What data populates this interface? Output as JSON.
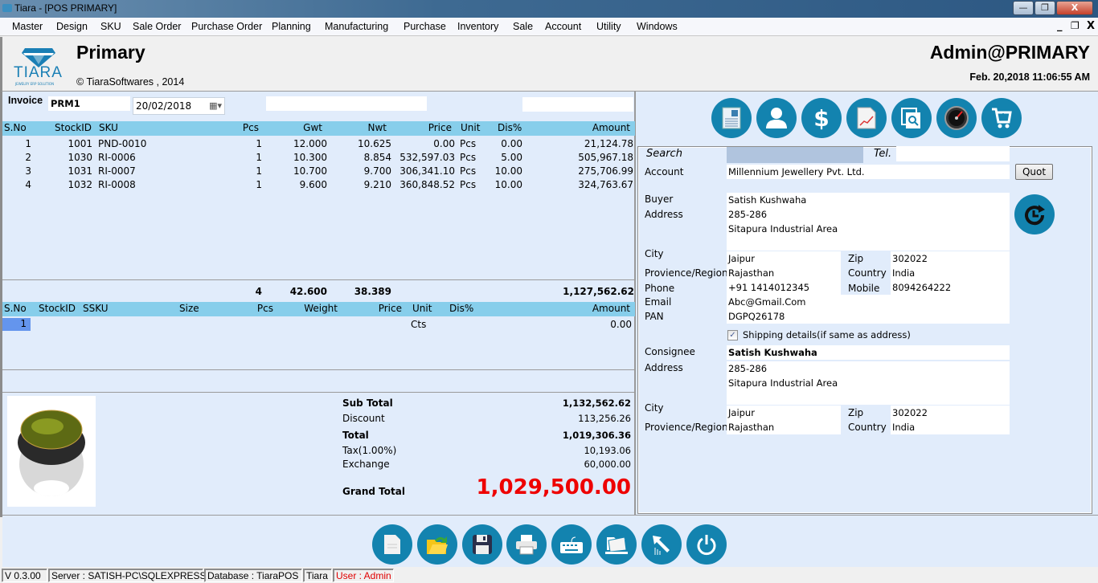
{
  "window": {
    "title": "Tiara - [POS PRIMARY]",
    "min_label": "—",
    "max_label": "❐",
    "close_label": "X"
  },
  "menu": {
    "items": [
      "Master",
      "Design",
      "SKU",
      "Sale Order",
      "Purchase Order",
      "Planning",
      "Manufacturing",
      "Purchase",
      "Inventory",
      "Sale",
      "Account",
      "Utility",
      "Windows"
    ],
    "mdi_min": "_",
    "mdi_restore": "❐",
    "mdi_close": "X"
  },
  "header": {
    "logo_text": "TIARA",
    "logo_sub": "JEWELRY ERP SOLUTION",
    "title": "Primary",
    "copyright": "©  TiaraSoftwares , 2014",
    "user": "Admin@PRIMARY",
    "datetime": "Feb. 20,2018 11:06:55 AM"
  },
  "invoice": {
    "label": "Invoice",
    "number": "PRM1",
    "date": "20/02/2018",
    "field3": "",
    "field4": ""
  },
  "items_grid": {
    "headers": [
      "S.No",
      "StockID",
      "SKU",
      "Pcs",
      "Gwt",
      "Nwt",
      "Price",
      "Unit",
      "Dis%",
      "Amount"
    ],
    "rows": [
      {
        "sno": "1",
        "stockid": "1001",
        "sku": "PND-0010",
        "pcs": "1",
        "gwt": "12.000",
        "nwt": "10.625",
        "price": "0.00",
        "unit": "Pcs",
        "dis": "0.00",
        "amount": "21,124.78"
      },
      {
        "sno": "2",
        "stockid": "1030",
        "sku": "RI-0006",
        "pcs": "1",
        "gwt": "10.300",
        "nwt": "8.854",
        "price": "532,597.03",
        "unit": "Pcs",
        "dis": "5.00",
        "amount": "505,967.18"
      },
      {
        "sno": "3",
        "stockid": "1031",
        "sku": "RI-0007",
        "pcs": "1",
        "gwt": "10.700",
        "nwt": "9.700",
        "price": "306,341.10",
        "unit": "Pcs",
        "dis": "10.00",
        "amount": "275,706.99"
      },
      {
        "sno": "4",
        "stockid": "1032",
        "sku": "RI-0008",
        "pcs": "1",
        "gwt": "9.600",
        "nwt": "9.210",
        "price": "360,848.52",
        "unit": "Pcs",
        "dis": "10.00",
        "amount": "324,763.67"
      }
    ],
    "totals": {
      "pcs": "4",
      "gwt": "42.600",
      "nwt": "38.389",
      "amount": "1,127,562.62"
    }
  },
  "stone_grid": {
    "headers": [
      "S.No",
      "StockID",
      "SSKU",
      "Size",
      "Pcs",
      "Weight",
      "Price",
      "Unit",
      "Dis%",
      "Amount"
    ],
    "rows": [
      {
        "sno": "1",
        "unit": "Cts",
        "amount": "0.00"
      }
    ]
  },
  "summary": {
    "subtotal_label": "Sub Total",
    "subtotal": "1,132,562.62",
    "discount_label": "Discount",
    "discount": "113,256.26",
    "total_label": "Total",
    "total": "1,019,306.36",
    "tax_label": "Tax(1.00%)",
    "tax": "10,193.06",
    "exchange_label": "Exchange",
    "exchange": "60,000.00",
    "grand_label": "Grand Total",
    "grand": "1,029,500.00",
    "grand_color": "#ee0000"
  },
  "toolbar_icons": [
    "invoice-icon",
    "customer-icon",
    "payment-icon",
    "report-icon",
    "search-document-icon",
    "dashboard-gauge-icon",
    "cart-icon"
  ],
  "customer": {
    "search_label": "Search",
    "search_value": "",
    "tel_label": "Tel.",
    "tel_value": "",
    "account_label": "Account",
    "account_value": "Millennium Jewellery Pvt. Ltd.",
    "quot_button": "Quot",
    "buyer_label": "Buyer",
    "buyer_value": "Satish Kushwaha",
    "address_label": "Address",
    "address1": "285-286",
    "address2": "Sitapura Industrial Area",
    "address3": "",
    "city_label": "City",
    "city_value": "Jaipur",
    "zip_label": "Zip",
    "zip_value": "302022",
    "region_label": "Provience/Region",
    "region_value": "Rajasthan",
    "country_label": "Country",
    "country_value": "India",
    "phone_label": "Phone",
    "phone_value": "+91 1414012345",
    "mobile_label": "Mobile",
    "mobile_value": "8094264222",
    "email_label": "Email",
    "email_value": "Abc@Gmail.Com",
    "pan_label": "PAN",
    "pan_value": "DGPQ26178"
  },
  "shipping": {
    "checkbox_label": "Shipping details(if same as address)",
    "checked": true,
    "consignee_label": "Consignee",
    "consignee_value": "Satish Kushwaha",
    "address_label": "Address",
    "address1": "285-286",
    "address2": "Sitapura Industrial Area",
    "address3": "",
    "city_label": "City",
    "city_value": "Jaipur",
    "zip_label": "Zip",
    "zip_value": "302022",
    "region_label": "Provience/Region",
    "region_value": "Rajasthan",
    "country_label": "Country",
    "country_value": "India"
  },
  "bottom_icons": [
    "new-document-icon",
    "open-folder-icon",
    "save-icon",
    "print-icon",
    "keyboard-icon",
    "folder-icon",
    "cursor-arrow-icon",
    "power-icon"
  ],
  "status": {
    "version": "V 0.3.00",
    "server": "Server : SATISH-PC\\SQLEXPRESS",
    "database": "Database : TiaraPOS",
    "company": "Tiara",
    "user": "User : Admin"
  },
  "colors": {
    "accent": "#1383af",
    "grid_header": "#87ceeb",
    "panel_bg": "#e1ecfb",
    "selected_cell": "#6495ed"
  }
}
